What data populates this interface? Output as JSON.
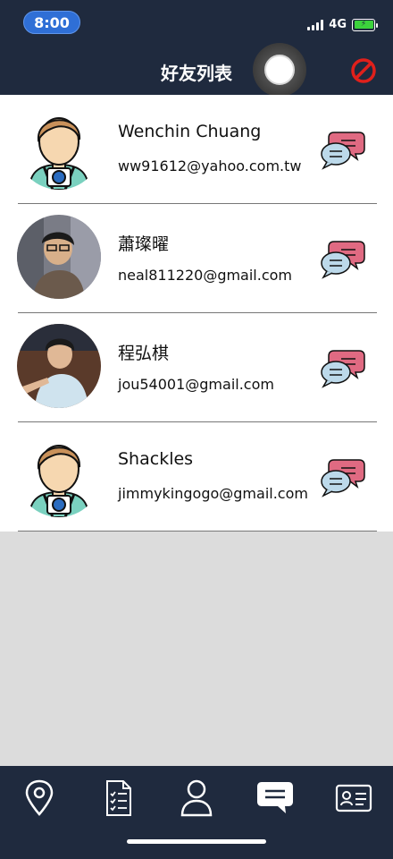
{
  "status_bar": {
    "time": "8:00",
    "network": "4G"
  },
  "header": {
    "title": "好友列表"
  },
  "friends": [
    {
      "name": "Wenchin Chuang",
      "email": "ww91612@yahoo.com.tw",
      "avatar": "cartoon-photographer"
    },
    {
      "name": "蕭璨曜",
      "email": "neal811220@gmail.com",
      "avatar": "photo"
    },
    {
      "name": "程弘棋",
      "email": "jou54001@gmail.com",
      "avatar": "photo"
    },
    {
      "name": "Shackles",
      "email": "jimmykingogo@gmail.com",
      "avatar": "cartoon-photographer"
    }
  ],
  "tab_bar": {
    "tabs": [
      "map-pin-icon",
      "checklist-icon",
      "user-icon",
      "chat-icon",
      "id-card-icon"
    ],
    "active": "chat-icon"
  },
  "colors": {
    "bar": "#1f2a3e",
    "block": "#e0201b",
    "bubble_pink": "#e06a82",
    "bubble_blue": "#bcd9ea"
  }
}
